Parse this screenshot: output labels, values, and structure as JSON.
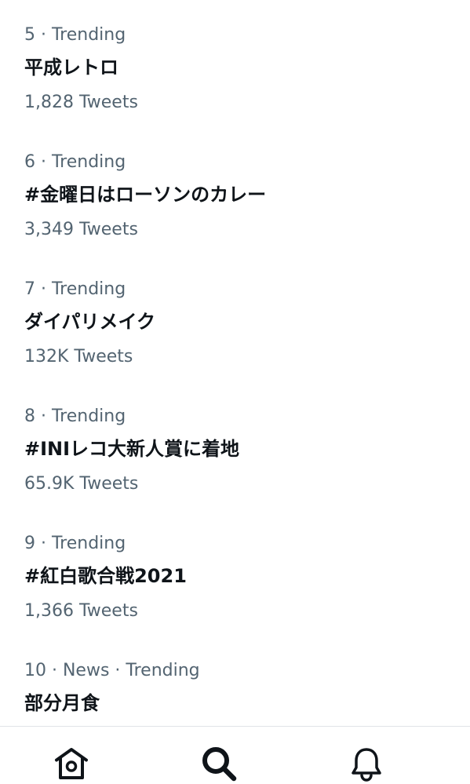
{
  "trends": [
    {
      "meta": "5 · Trending",
      "title": "平成レトロ",
      "count": "1,828 Tweets"
    },
    {
      "meta": "6 · Trending",
      "title": "#金曜日はローソンのカレー",
      "count": "3,349 Tweets"
    },
    {
      "meta": "7 · Trending",
      "title": "ダイパリメイク",
      "count": "132K Tweets"
    },
    {
      "meta": "8 · Trending",
      "title": "#INIレコ大新人賞に着地",
      "count": "65.9K Tweets"
    },
    {
      "meta": "9 · Trending",
      "title": "#紅白歌合戦2021",
      "count": "1,366 Tweets"
    },
    {
      "meta": "10 · News · Trending",
      "title": "部分月食",
      "count": ""
    }
  ],
  "tab_bar": {
    "icons": [
      "home-icon",
      "search-icon",
      "notifications-bell-icon"
    ],
    "active": "search-icon"
  },
  "colors": {
    "primary_text": "#0f1419",
    "secondary_text": "#536471",
    "divider": "#e1e4e8"
  }
}
